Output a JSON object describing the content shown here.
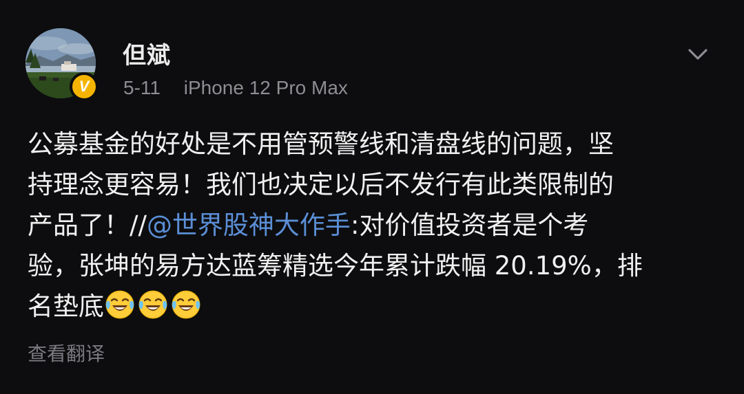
{
  "post": {
    "author": {
      "name": "但斌",
      "verified": true,
      "verified_badge": "V"
    },
    "meta": {
      "date": "5-11",
      "device": "iPhone 12 Pro Max"
    },
    "menu_icon": "chevron-down-icon",
    "content": {
      "line1": "公募基金的好处是不用管预警线和清盘线的问题，坚",
      "line2": "持理念更容易！我们也决定以后不发行有此类限制的",
      "line3_pre": "产品了！//",
      "mention": "@世界股神大作手",
      "line3_post": ":对价值投资者是个考",
      "line4": "验，张坤的易方达蓝筹精选今年累计跌幅 20.19%，排",
      "line5": "名垫底",
      "emoji_name": "laughing-crying-emoji",
      "emoji_count": 3
    },
    "translate_label": "查看翻译"
  },
  "colors": {
    "background": "#0d0d0f",
    "text": "#f0f0f0",
    "meta": "#8d8d92",
    "mention": "#5b8fd6",
    "badge": "#f5b400"
  }
}
